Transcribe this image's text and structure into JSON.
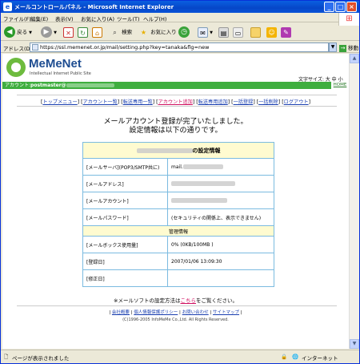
{
  "window": {
    "title": "メールコントロールパネル - Microsoft Internet Explorer",
    "minimize": "_",
    "maximize": "□",
    "close": "×"
  },
  "menu": [
    "ファイル(F)",
    "編集(E)",
    "表示(V)",
    "お気に入り(A)",
    "ツール(T)",
    "ヘルプ(H)"
  ],
  "toolbar": {
    "back": "戻る",
    "search": "検索",
    "favorites": "お気に入り"
  },
  "address": {
    "label": "アドレス(D)",
    "url": "https://ssl.memenet.or.jp/mail/setting.php?key=tanaka&flg=new",
    "go": "移動"
  },
  "header": {
    "logo_name": "MeMeNet",
    "logo_tagline": "Intellectual Internet Public Site",
    "font_size_label": "文字サイズ:",
    "font_size_icons": "大 中 小",
    "account_label": "アカウント:",
    "account_user": "postmaster@",
    "home": "HOME"
  },
  "nav": [
    {
      "label": "トップメニュー",
      "active": false
    },
    {
      "label": "アカウント一覧",
      "active": false
    },
    {
      "label": "転送専用一覧",
      "active": false
    },
    {
      "label": "アカウント追加",
      "active": true
    },
    {
      "label": "転送専用追加",
      "active": false
    },
    {
      "label": "一括登録",
      "active": false
    },
    {
      "label": "一括削除",
      "active": false
    },
    {
      "label": "ログアウト",
      "active": false
    }
  ],
  "message": {
    "line1": "メールアカウント登録が完了いたしました。",
    "line2": "設定情報は以下の通りです。"
  },
  "table": {
    "title_suffix": "の設定情報",
    "rows": [
      {
        "key": "[メールサーバ](POP3/SMTP共に)",
        "value": "mail."
      },
      {
        "key": "[メールアドレス]",
        "value": ""
      },
      {
        "key": "[メールアカウント]",
        "value": ""
      },
      {
        "key": "[メールパスワード]",
        "value": "(セキュリティの関係上、表示できません)"
      }
    ],
    "section": "管理情報",
    "rows2": [
      {
        "key": "[メールボックス使用量]",
        "value": "0% (0KB/100MB )"
      },
      {
        "key": "[登録日]",
        "value": "2007/01/06 13:09:30"
      },
      {
        "key": "[修正日]",
        "value": ""
      }
    ]
  },
  "note": {
    "prefix": "※メールソフトの設定方法は",
    "link": "こちら",
    "suffix": "をご覧ください。"
  },
  "footer": {
    "links": [
      "会社概要",
      "個人情報保護ポリシー",
      "お問い合わせ",
      "サイトマップ"
    ],
    "copyright": "(C)1996-2005 InfoMeMe Co.,Ltd. All Rights Reserved."
  },
  "status": {
    "text": "ページが表示されました",
    "zone": "インターネット"
  }
}
